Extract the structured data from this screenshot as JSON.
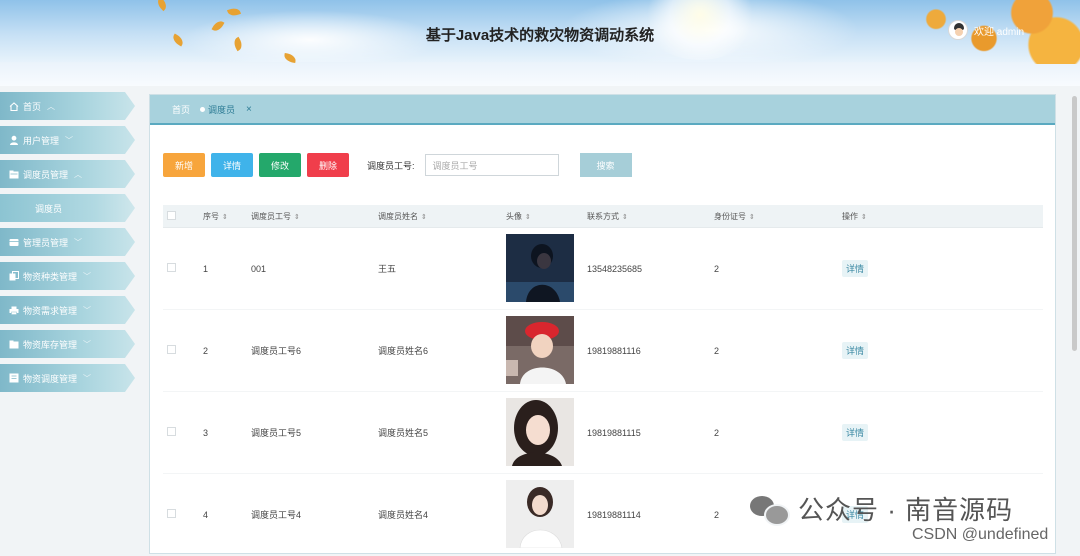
{
  "header": {
    "title": "基于Java技术的救灾物资调动系统",
    "welcome": "欢迎 admin"
  },
  "sidebar": {
    "items": [
      {
        "label": "首页",
        "icon": "home-icon",
        "chev": "^"
      },
      {
        "label": "用户管理",
        "icon": "user-icon",
        "chev": "v"
      },
      {
        "label": "调度员管理",
        "icon": "folder-icon",
        "chev": "^"
      },
      {
        "label": "调度员",
        "icon": "",
        "chev": "",
        "sub": true
      },
      {
        "label": "管理员管理",
        "icon": "card-icon",
        "chev": "v"
      },
      {
        "label": "物资种类管理",
        "icon": "copy-icon",
        "chev": "v"
      },
      {
        "label": "物资需求管理",
        "icon": "print-icon",
        "chev": "v"
      },
      {
        "label": "物资库存管理",
        "icon": "folder-icon",
        "chev": "v"
      },
      {
        "label": "物资调度管理",
        "icon": "doc-icon",
        "chev": "v"
      }
    ]
  },
  "tabs": {
    "home": "首页",
    "active": "调度员",
    "close": "×"
  },
  "toolbar": {
    "add": "新增",
    "detail": "详情",
    "edit": "修改",
    "delete": "删除",
    "search_label": "调度员工号:",
    "search_placeholder": "调度员工号",
    "search_button": "搜索"
  },
  "table": {
    "headers": [
      "序号",
      "调度员工号",
      "调度员姓名",
      "头像",
      "联系方式",
      "身份证号",
      "操作"
    ],
    "rows": [
      {
        "no": "1",
        "code": "001",
        "name": "王五",
        "phone": "13548235685",
        "id": "2",
        "action": "详情"
      },
      {
        "no": "2",
        "code": "调度员工号6",
        "name": "调度员姓名6",
        "phone": "19819881116",
        "id": "2",
        "action": "详情"
      },
      {
        "no": "3",
        "code": "调度员工号5",
        "name": "调度员姓名5",
        "phone": "19819881115",
        "id": "2",
        "action": "详情"
      },
      {
        "no": "4",
        "code": "调度员工号4",
        "name": "调度员姓名4",
        "phone": "19819881114",
        "id": "2",
        "action": "详情"
      }
    ]
  },
  "watermark": {
    "text": "公众号 · 南音源码",
    "csdn": "CSDN @undefined"
  }
}
